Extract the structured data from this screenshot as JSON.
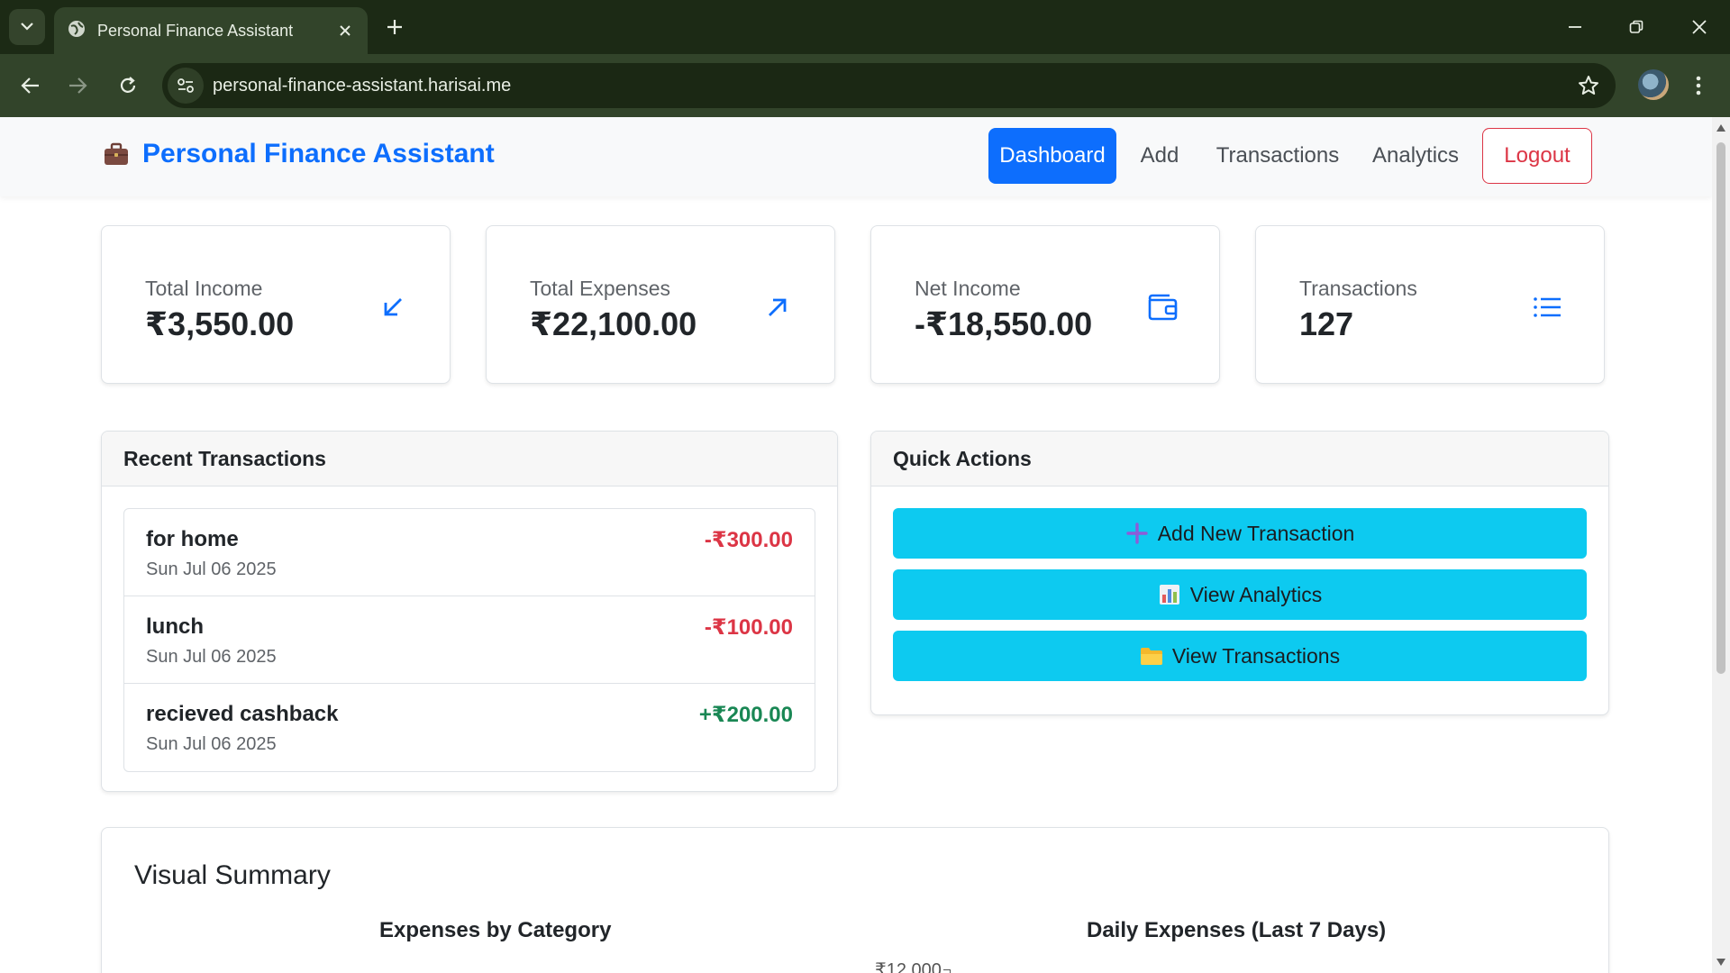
{
  "browser": {
    "tab_title": "Personal Finance Assistant",
    "url": "personal-finance-assistant.harisai.me"
  },
  "navbar": {
    "brand": "Personal Finance Assistant",
    "brand_icon": "briefcase-icon",
    "links": [
      "Dashboard",
      "Add",
      "Transactions",
      "Analytics"
    ],
    "active": "Dashboard",
    "logout": "Logout",
    "accent_color": "#0d6efd"
  },
  "stats": [
    {
      "label": "Total Income",
      "value": "₹3,550.00",
      "icon": "arrow-down-left-icon"
    },
    {
      "label": "Total Expenses",
      "value": "₹22,100.00",
      "icon": "arrow-up-right-icon"
    },
    {
      "label": "Net Income",
      "value": "-₹18,550.00",
      "icon": "wallet-icon"
    },
    {
      "label": "Transactions",
      "value": "127",
      "icon": "list-icon"
    }
  ],
  "recent": {
    "title": "Recent Transactions",
    "items": [
      {
        "description": "for home",
        "date": "Sun Jul 06 2025",
        "amount": "-₹300.00",
        "type": "expense"
      },
      {
        "description": "lunch",
        "date": "Sun Jul 06 2025",
        "amount": "-₹100.00",
        "type": "expense"
      },
      {
        "description": "recieved cashback",
        "date": "Sun Jul 06 2025",
        "amount": "+₹200.00",
        "type": "income"
      }
    ]
  },
  "quick_actions": {
    "title": "Quick Actions",
    "buttons": [
      {
        "label": "Add New Transaction",
        "icon": "plus-icon"
      },
      {
        "label": "View Analytics",
        "icon": "bar-chart-icon"
      },
      {
        "label": "View Transactions",
        "icon": "folder-icon"
      }
    ],
    "button_color": "#0dcaf0"
  },
  "visual_summary": {
    "title": "Visual Summary",
    "chart1_title": "Expenses by Category",
    "chart2_title": "Daily Expenses (Last 7 Days)",
    "y_tick_top": "₹12,000"
  },
  "colors": {
    "expense": "#dc3545",
    "income": "#198754"
  }
}
